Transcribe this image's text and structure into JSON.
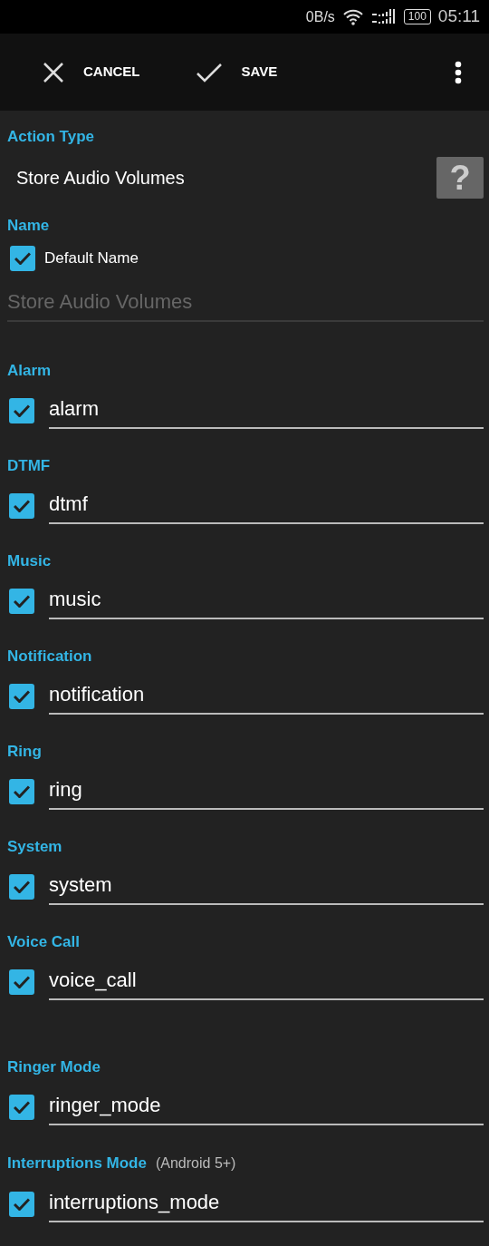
{
  "status_bar": {
    "speed": "0B/s",
    "battery": "100",
    "time": "05:11"
  },
  "toolbar": {
    "cancel": "CANCEL",
    "save": "SAVE"
  },
  "action_type": {
    "label": "Action Type",
    "value": "Store Audio Volumes",
    "help": "?"
  },
  "name": {
    "label": "Name",
    "default_name": {
      "label": "Default Name",
      "checked": true
    },
    "placeholder": "Store Audio Volumes"
  },
  "volumes": [
    {
      "label": "Alarm",
      "checked": true,
      "value": "alarm"
    },
    {
      "label": "DTMF",
      "checked": true,
      "value": "dtmf"
    },
    {
      "label": "Music",
      "checked": true,
      "value": "music"
    },
    {
      "label": "Notification",
      "checked": true,
      "value": "notification"
    },
    {
      "label": "Ring",
      "checked": true,
      "value": "ring"
    },
    {
      "label": "System",
      "checked": true,
      "value": "system"
    },
    {
      "label": "Voice Call",
      "checked": true,
      "value": "voice_call"
    }
  ],
  "modes": [
    {
      "label": "Ringer Mode",
      "checked": true,
      "value": "ringer_mode"
    },
    {
      "label": "Interruptions Mode",
      "note": "(Android 5+)",
      "checked": true,
      "value": "interruptions_mode"
    }
  ]
}
